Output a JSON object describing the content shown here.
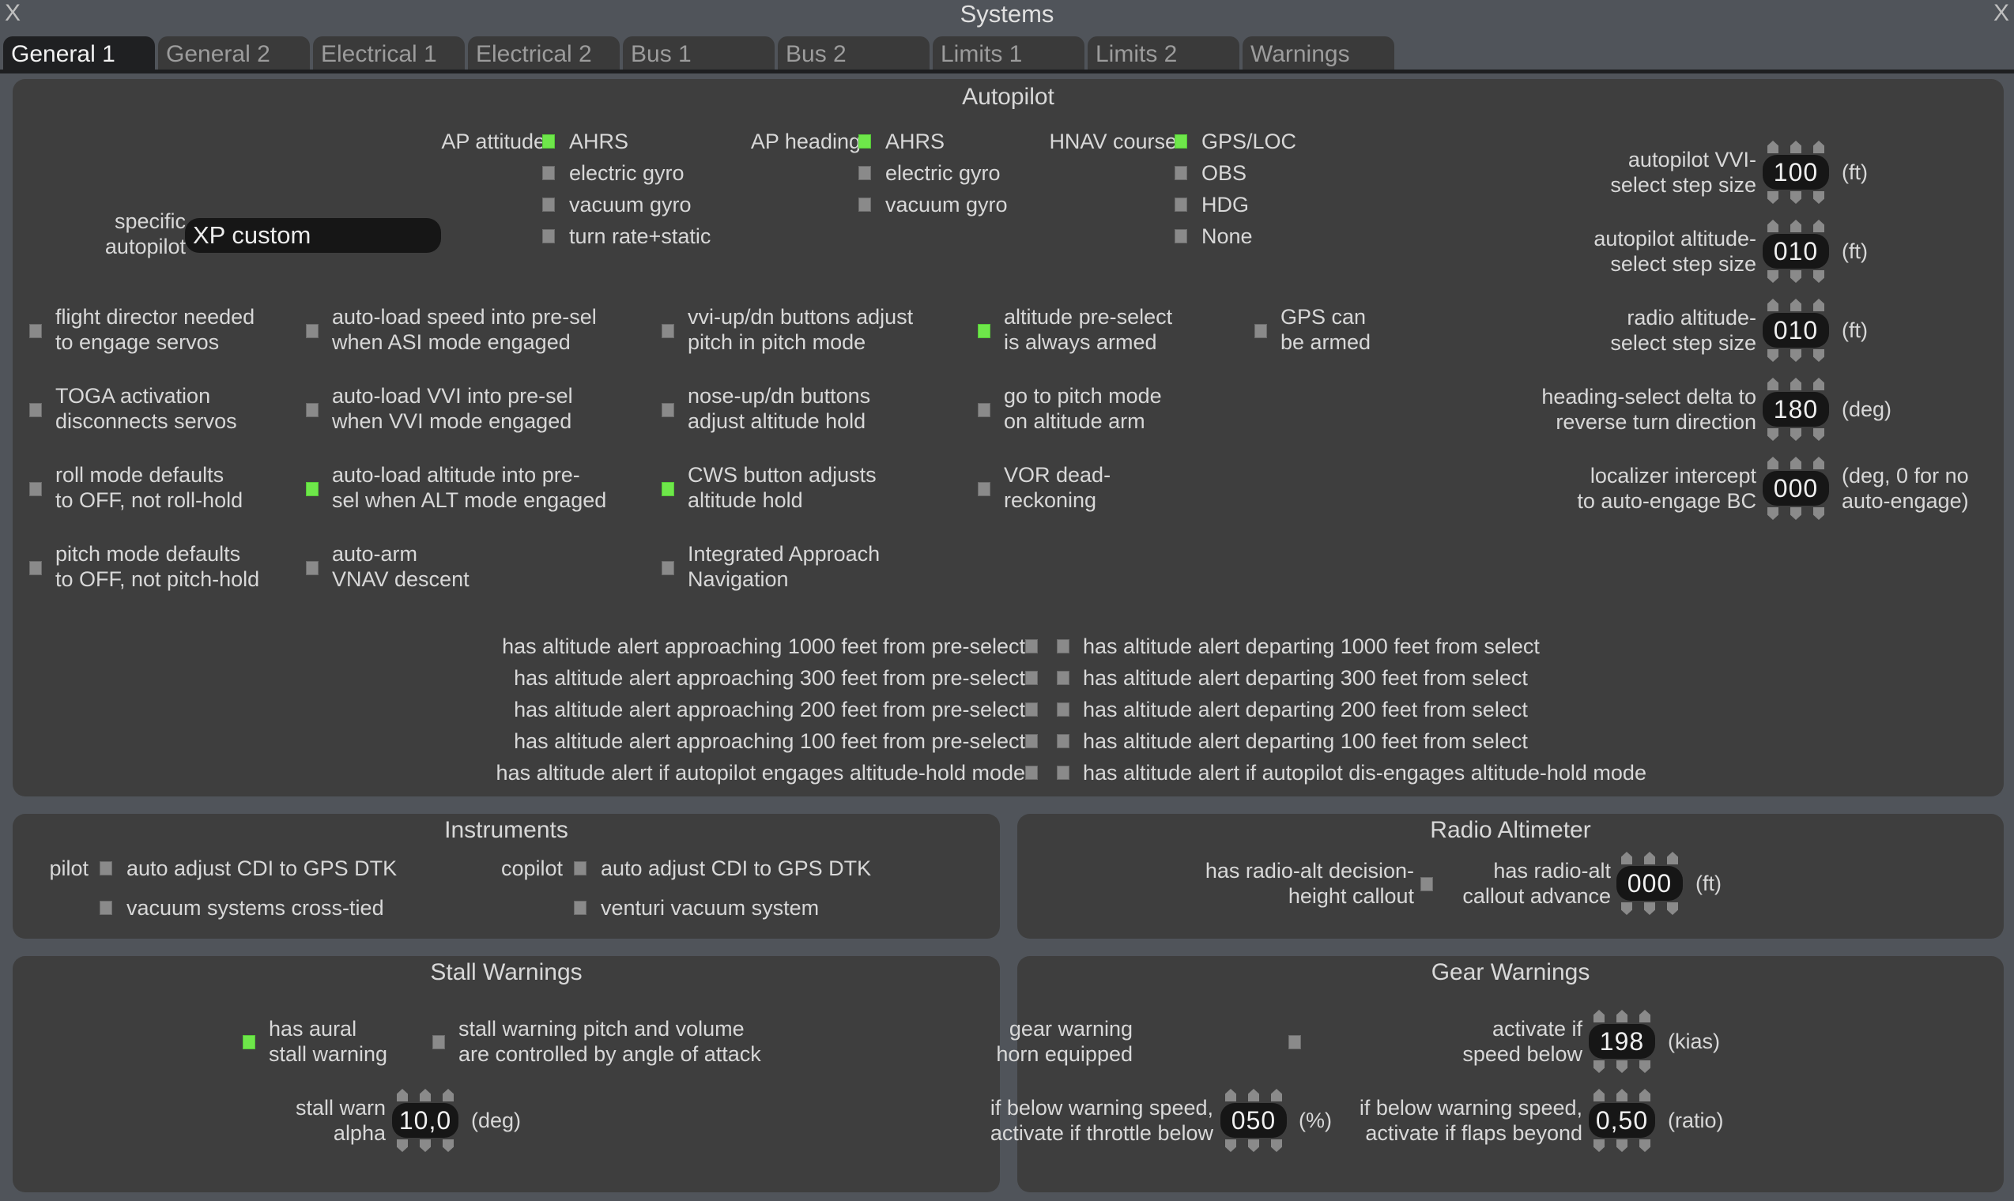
{
  "window": {
    "title": "Systems",
    "close_left": "X",
    "close_right": "X"
  },
  "tabs": [
    {
      "label": "General 1",
      "active": true
    },
    {
      "label": "General 2"
    },
    {
      "label": "Electrical 1"
    },
    {
      "label": "Electrical 2"
    },
    {
      "label": "Bus 1"
    },
    {
      "label": "Bus 2"
    },
    {
      "label": "Limits 1"
    },
    {
      "label": "Limits 2"
    },
    {
      "label": "Warnings"
    }
  ],
  "colors": {
    "checked": "#6ee74a",
    "unchecked": "#8a8a8a",
    "panel": "#3e3e3e",
    "background": "#50545a"
  },
  "autopilot": {
    "title": "Autopilot",
    "specific_autopilot_label_1": "specific",
    "specific_autopilot_label_2": "autopilot",
    "specific_autopilot_value": "XP custom",
    "ap_attitude": {
      "label": "AP attitude",
      "options": [
        {
          "label": "AHRS",
          "checked": true
        },
        {
          "label": "electric gyro",
          "checked": false
        },
        {
          "label": "vacuum gyro",
          "checked": false
        },
        {
          "label": "turn rate+static",
          "checked": false
        }
      ]
    },
    "ap_heading": {
      "label": "AP heading",
      "options": [
        {
          "label": "AHRS",
          "checked": true
        },
        {
          "label": "electric gyro",
          "checked": false
        },
        {
          "label": "vacuum gyro",
          "checked": false
        }
      ]
    },
    "hnav_course": {
      "label": "HNAV course",
      "options": [
        {
          "label": "GPS/LOC",
          "checked": true
        },
        {
          "label": "OBS",
          "checked": false
        },
        {
          "label": "HDG",
          "checked": false
        },
        {
          "label": "None",
          "checked": false
        }
      ]
    },
    "options": [
      {
        "l1": "flight director needed",
        "l2": "to engage servos",
        "checked": false
      },
      {
        "l1": "auto-load speed into pre-sel",
        "l2": "when ASI mode engaged",
        "checked": false
      },
      {
        "l1": "vvi-up/dn buttons adjust",
        "l2": "pitch in pitch mode",
        "checked": false
      },
      {
        "l1": "altitude pre-select",
        "l2": "is always armed",
        "checked": true
      },
      {
        "l1": "GPS can",
        "l2": "be armed",
        "checked": false
      },
      {
        "l1": "TOGA activation",
        "l2": "disconnects servos",
        "checked": false
      },
      {
        "l1": "auto-load VVI into pre-sel",
        "l2": "when VVI mode engaged",
        "checked": false
      },
      {
        "l1": "nose-up/dn buttons",
        "l2": "adjust altitude hold",
        "checked": false
      },
      {
        "l1": "go to pitch mode",
        "l2": "on altitude arm",
        "checked": false
      },
      {
        "l1": "roll mode defaults",
        "l2": "to OFF, not roll-hold",
        "checked": false
      },
      {
        "l1": "auto-load altitude into pre-",
        "l2": "sel when ALT mode engaged",
        "checked": true
      },
      {
        "l1": "CWS button adjusts",
        "l2": "altitude hold",
        "checked": true
      },
      {
        "l1": "VOR dead-",
        "l2": "reckoning",
        "checked": false
      },
      {
        "l1": "pitch mode defaults",
        "l2": "to OFF, not pitch-hold",
        "checked": false
      },
      {
        "l1": "auto-arm",
        "l2": "VNAV descent",
        "checked": false
      },
      {
        "l1": "Integrated Approach",
        "l2": "Navigation",
        "checked": false
      }
    ],
    "spinners": [
      {
        "l1": "autopilot VVI-",
        "l2": "select step size",
        "value": "100",
        "unit": "(ft)"
      },
      {
        "l1": "autopilot altitude-",
        "l2": "select step size",
        "value": "010",
        "unit": "(ft)"
      },
      {
        "l1": "radio altitude-",
        "l2": "select step size",
        "value": "010",
        "unit": "(ft)"
      },
      {
        "l1": "heading-select delta to",
        "l2": "reverse turn direction",
        "value": "180",
        "unit": "(deg)"
      },
      {
        "l1": "localizer intercept",
        "l2": "to auto-engage BC",
        "value": "000",
        "unit": "(deg, 0 for no",
        "unit2": "auto-engage)"
      }
    ],
    "alerts_left": [
      {
        "label": "has altitude alert approaching 1000 feet from pre-select",
        "checked": false
      },
      {
        "label": "has altitude alert approaching 300 feet from pre-select",
        "checked": false
      },
      {
        "label": "has altitude alert approaching 200 feet from pre-select",
        "checked": false
      },
      {
        "label": "has altitude alert approaching 100 feet from pre-select",
        "checked": false
      },
      {
        "label": "has altitude alert if autopilot engages altitude-hold mode",
        "checked": false
      }
    ],
    "alerts_right": [
      {
        "label": "has altitude alert departing 1000 feet from select",
        "checked": false
      },
      {
        "label": "has altitude alert departing 300 feet from select",
        "checked": false
      },
      {
        "label": "has altitude alert departing 200 feet from select",
        "checked": false
      },
      {
        "label": "has altitude alert departing 100 feet from select",
        "checked": false
      },
      {
        "label": "has altitude alert if autopilot dis-engages altitude-hold mode",
        "checked": false
      }
    ]
  },
  "instruments": {
    "title": "Instruments",
    "pilot_label": "pilot",
    "copilot_label": "copilot",
    "pilot_cdi": {
      "label": "auto adjust CDI to GPS DTK",
      "checked": false
    },
    "pilot_vacuum": {
      "label": "vacuum systems cross-tied",
      "checked": false
    },
    "copilot_cdi": {
      "label": "auto adjust CDI to GPS DTK",
      "checked": false
    },
    "copilot_venturi": {
      "label": "venturi vacuum system",
      "checked": false
    }
  },
  "radio_altimeter": {
    "title": "Radio Altimeter",
    "dh_l1": "has radio-alt decision-",
    "dh_l2": "height callout",
    "dh_checked": false,
    "adv_l1": "has radio-alt",
    "adv_l2": "callout advance",
    "adv_value": "000",
    "adv_unit": "(ft)"
  },
  "stall": {
    "title": "Stall Warnings",
    "aural_l1": "has aural",
    "aural_l2": "stall warning",
    "aural_checked": true,
    "aoa_l1": "stall warning pitch and volume",
    "aoa_l2": "are controlled by angle of attack",
    "aoa_checked": false,
    "alpha_l1": "stall warn",
    "alpha_l2": "alpha",
    "alpha_value": "10,0",
    "alpha_unit": "(deg)"
  },
  "gear": {
    "title": "Gear Warnings",
    "horn_l1": "gear warning",
    "horn_l2": "horn equipped",
    "horn_checked": false,
    "speed_l1": "activate if",
    "speed_l2": "speed below",
    "speed_value": "198",
    "speed_unit": "(kias)",
    "throttle_l1": "if below warning speed,",
    "throttle_l2": "activate if throttle below",
    "throttle_value": "050",
    "throttle_unit": "(%)",
    "flaps_l1": "if below warning speed,",
    "flaps_l2": "activate if flaps beyond",
    "flaps_value": "0,50",
    "flaps_unit": "(ratio)"
  }
}
